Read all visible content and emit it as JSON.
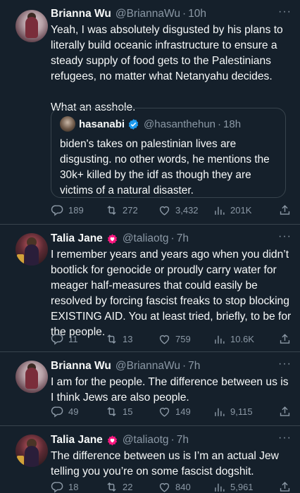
{
  "tweets": [
    {
      "name": "Brianna Wu",
      "handle": "@BriannaWu",
      "sep": "·",
      "time": "10h",
      "more": "···",
      "text": "Yeah, I was absolutely disgusted by his plans to literally build oceanic infrastructure to ensure a steady supply of food gets to the Palestinians refugees, no matter what Netanyahu decides.\n\nWhat an asshole.",
      "quote": {
        "name": "hasanabi",
        "handle": "@hasanthehun",
        "sep": "·",
        "time": "18h",
        "text": "biden's takes on palestinian lives are disgusting. no other words, he mentions the 30k+ killed by the idf as though they are victims of a natural disaster."
      },
      "replies": "189",
      "retweets": "272",
      "likes": "3,432",
      "views": "201K"
    },
    {
      "name": "Talia Jane",
      "handle": "@taliaotg",
      "sep": "·",
      "time": "7h",
      "more": "···",
      "text": "I remember years and years ago when you didn’t bootlick for genocide or proudly carry water for meager half-measures that could easily be resolved by forcing fascist freaks to stop blocking EXISTING AID. You at least tried, briefly, to be for the people.",
      "replies": "11",
      "retweets": "13",
      "likes": "759",
      "views": "10.6K"
    },
    {
      "name": "Brianna Wu",
      "handle": "@BriannaWu",
      "sep": "·",
      "time": "7h",
      "more": "···",
      "text": "I am for the people. The difference between us is I think Jews are also people.",
      "replies": "49",
      "retweets": "15",
      "likes": "149",
      "views": "9,115"
    },
    {
      "name": "Talia Jane",
      "handle": "@taliaotg",
      "sep": "·",
      "time": "7h",
      "more": "···",
      "text": "The difference between us is I’m an actual Jew telling you you’re on some fascist dogshit.",
      "replies": "18",
      "retweets": "22",
      "likes": "840",
      "views": "5,961"
    }
  ],
  "colors": {
    "background": "#15202b",
    "text": "#f7f9f9",
    "secondary": "#8b98a5",
    "border": "#38444d",
    "verified": "#1d9bf0",
    "heart_badge": "#f91880"
  }
}
